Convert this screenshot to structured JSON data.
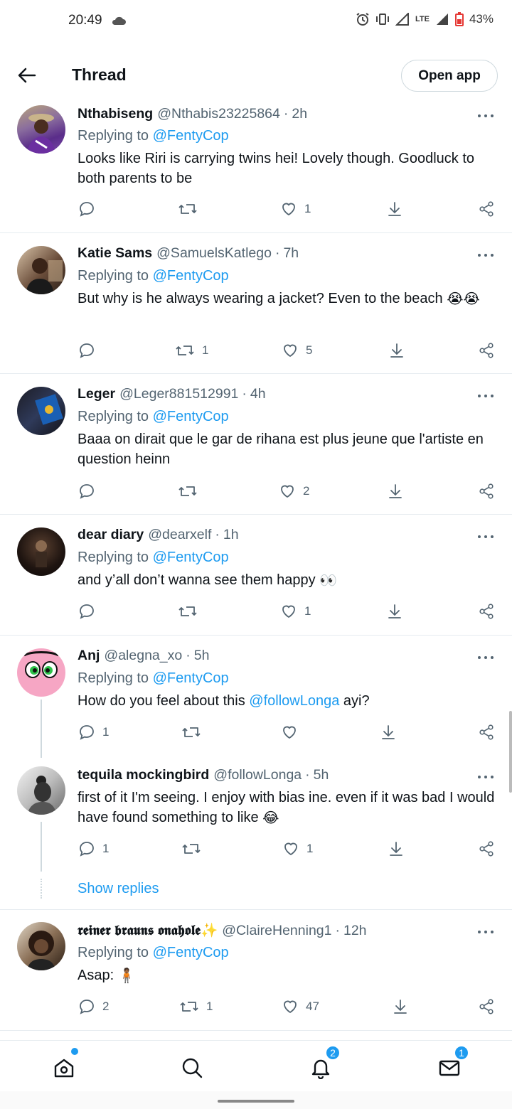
{
  "status_bar": {
    "time": "20:49",
    "network": "LTE",
    "battery": "43%"
  },
  "header": {
    "title": "Thread",
    "open_app": "Open app"
  },
  "colors": {
    "accent": "#1d9bf0",
    "secondary_text": "#536471",
    "border": "#e6ecf0"
  },
  "tweets": [
    {
      "name": "Nthabiseng",
      "handle": "@Nthabis23225864",
      "time": "2h",
      "replying_label": "Replying to",
      "replying_to": "@FentyCop",
      "text": "Looks like Riri is carrying twins hei! Lovely though. Goodluck to both parents to be",
      "replies": "",
      "retweets": "",
      "likes": "1"
    },
    {
      "name": "Katie Sams",
      "handle": "@SamuelsKatlego",
      "time": "7h",
      "replying_label": "Replying to",
      "replying_to": "@FentyCop",
      "text": "But why is he always wearing a jacket? Even to the beach",
      "emoji": "😭😭",
      "replies": "",
      "retweets": "1",
      "likes": "5"
    },
    {
      "name": "Leger",
      "handle": "@Leger881512991",
      "time": "4h",
      "replying_label": "Replying to",
      "replying_to": "@FentyCop",
      "text": "Baaa on dirait que  le gar de rihana est plus jeune que l'artiste en question heinn",
      "replies": "",
      "retweets": "",
      "likes": "2"
    },
    {
      "name": "dear diary",
      "handle": "@dearxelf",
      "time": "1h",
      "replying_label": "Replying to",
      "replying_to": "@FentyCop",
      "text": "and y’all don’t wanna see them happy",
      "emoji": "👀",
      "replies": "",
      "retweets": "",
      "likes": "1"
    },
    {
      "name": "Anj",
      "handle": "@alegna_xo",
      "time": "5h",
      "replying_label": "Replying to",
      "replying_to": "@FentyCop",
      "text_before": "How do you feel about this",
      "text_mention": "@followLonga",
      "text_after": "ayi?",
      "replies": "1",
      "retweets": "",
      "likes": ""
    },
    {
      "name": "tequila mockingbird",
      "handle": "@followLonga",
      "time": "5h",
      "text": "first of it I'm seeing. I enjoy with bias ine. even if it was bad I would have found something to like",
      "emoji": "😂",
      "replies": "1",
      "retweets": "",
      "likes": "1",
      "show_replies": "Show replies"
    },
    {
      "name": "𝖗𝖊𝖎𝖓𝖊𝖗 𝖇𝖗𝖆𝖚𝖓𝖘 𝖔𝖓𝖆𝖍𝖔𝖑𝖊",
      "name_emoji": "✨",
      "handle": "@ClaireHenning1",
      "time": "12h",
      "replying_label": "Replying to",
      "replying_to": "@FentyCop",
      "text": "Asap:",
      "emoji": "🧍🏾",
      "replies": "2",
      "retweets": "1",
      "likes": "47"
    }
  ],
  "bottom_nav": {
    "notifications_badge": "2",
    "messages_badge": "1"
  },
  "icons": [
    "back-arrow-icon",
    "reply-icon",
    "retweet-icon",
    "like-icon",
    "bookmark-download-icon",
    "share-icon",
    "home-icon",
    "search-icon",
    "bell-icon",
    "mail-icon",
    "more-icon"
  ]
}
